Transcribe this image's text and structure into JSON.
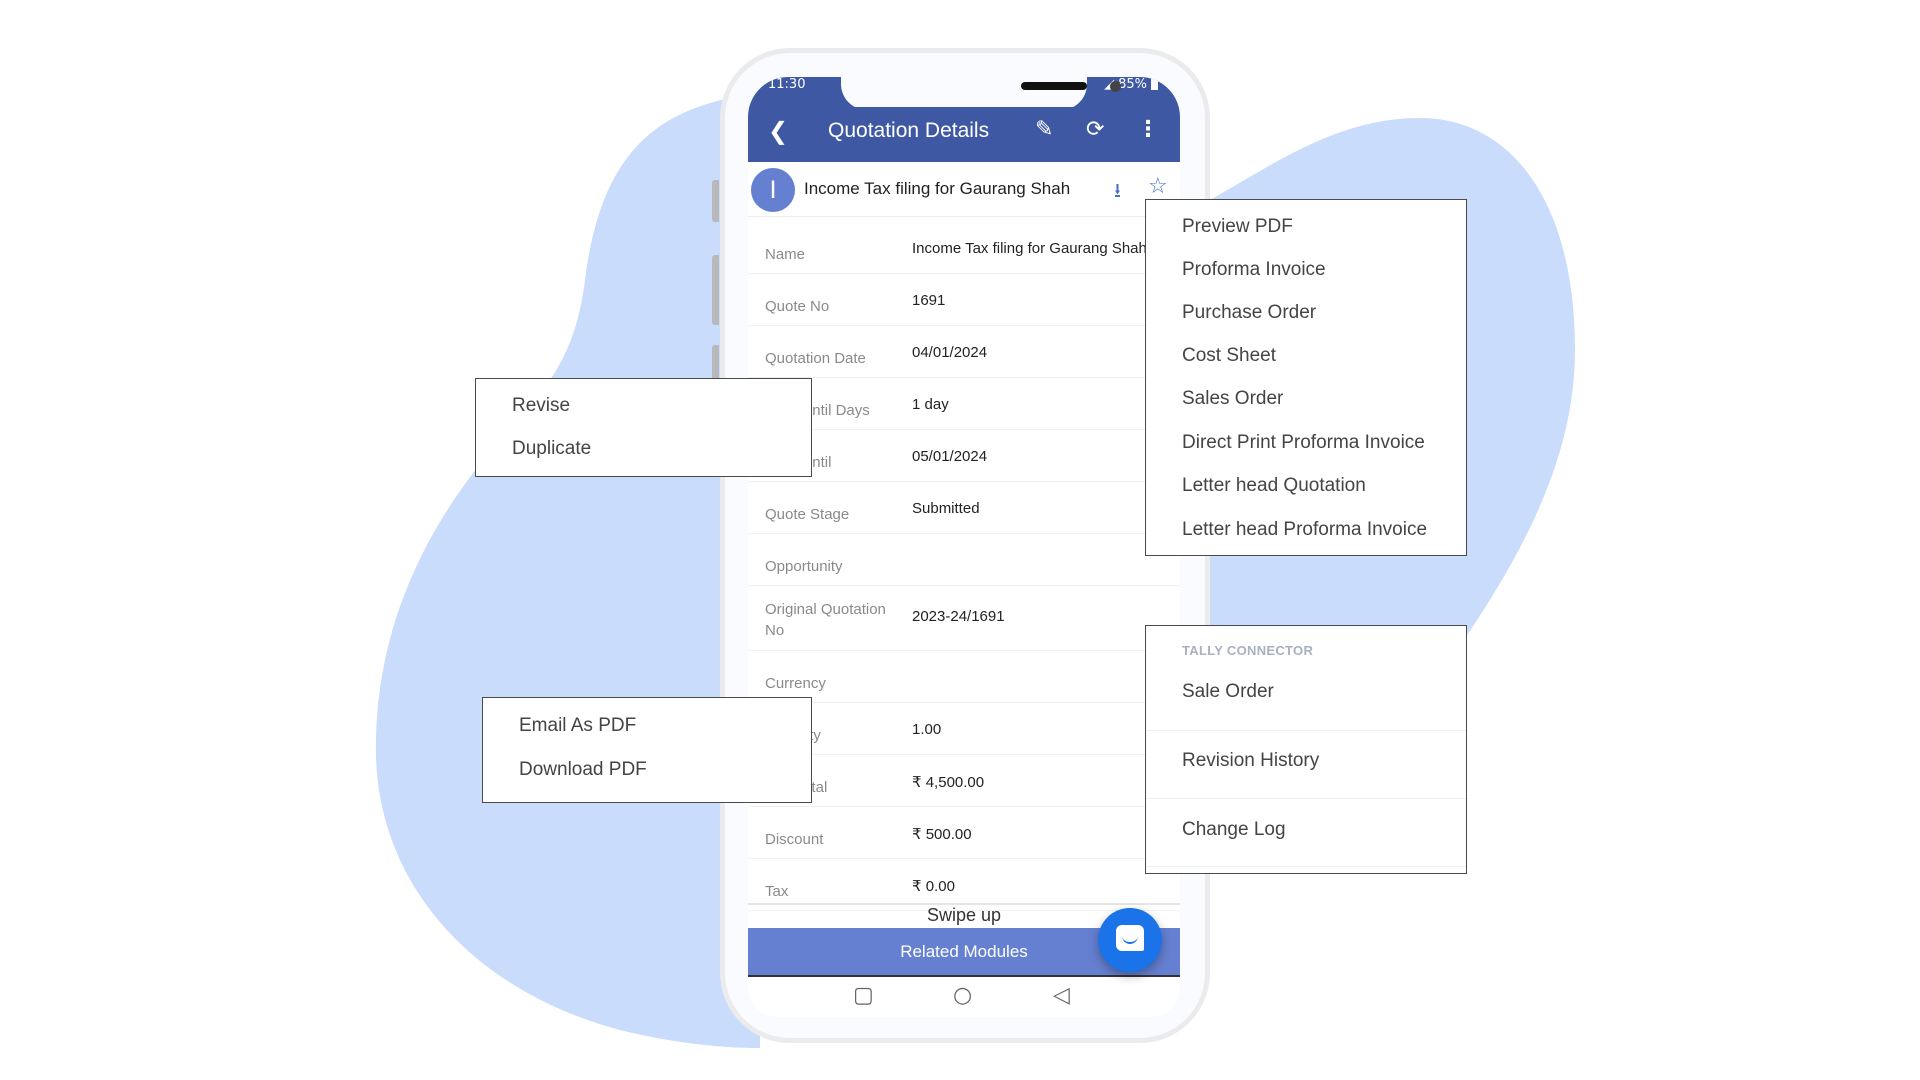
{
  "colors": {
    "blob": "#c9dcfb",
    "app_bar": "#3f58a3",
    "accent": "#6580d1",
    "fab": "#1a73e8"
  },
  "status_bar": {
    "time": "11:30",
    "battery": "85%"
  },
  "app_bar": {
    "title": "Quotation Details",
    "back_icon": "chevron-left-icon",
    "edit_icon": "pencil-icon",
    "refresh_icon": "refresh-icon",
    "more_icon": "kebab-menu-icon"
  },
  "record": {
    "avatar_letter": "I",
    "title": "Income Tax filing for Gaurang Shah",
    "download_icon": "download-icon",
    "star_icon": "star-icon"
  },
  "fields": [
    {
      "label": "Name",
      "value": "Income Tax filing for Gaurang Shah"
    },
    {
      "label": "Quote No",
      "value": "1691"
    },
    {
      "label": "Quotation Date",
      "value": "04/01/2024"
    },
    {
      "label": "Valid Until Days",
      "value": "1 day"
    },
    {
      "label": "Valid Until",
      "value": "05/01/2024"
    },
    {
      "label": "Quote Stage",
      "value": "Submitted"
    },
    {
      "label": "Opportunity",
      "value": ""
    },
    {
      "label": "Original Quotation No",
      "value": "2023-24/1691"
    },
    {
      "label": "Currency",
      "value": ""
    },
    {
      "label": "Quantity",
      "value": "1.00"
    },
    {
      "label": "Sub Total",
      "value": "₹ 4,500.00"
    },
    {
      "label": "Discount",
      "value": "₹ 500.00"
    },
    {
      "label": "Tax",
      "value": "₹ 0.00"
    }
  ],
  "swipe_hint": "Swipe up",
  "related_modules": "Related Modules",
  "nav": {
    "recents": "▢",
    "home": "○",
    "back": "◁"
  },
  "menus": {
    "revise_menu": [
      "Revise",
      "Duplicate"
    ],
    "pdf_menu": [
      "Email As PDF",
      "Download PDF"
    ],
    "print_menu": [
      "Preview PDF",
      "Proforma Invoice",
      "Purchase Order",
      "Cost Sheet",
      "Sales Order",
      "Direct Print Proforma Invoice",
      "Letter head Quotation",
      "Letter head Proforma Invoice"
    ],
    "more_menu": {
      "section_header": "TALLY CONNECTOR",
      "items": [
        "Sale Order",
        "Revision History",
        "Change Log"
      ]
    }
  }
}
